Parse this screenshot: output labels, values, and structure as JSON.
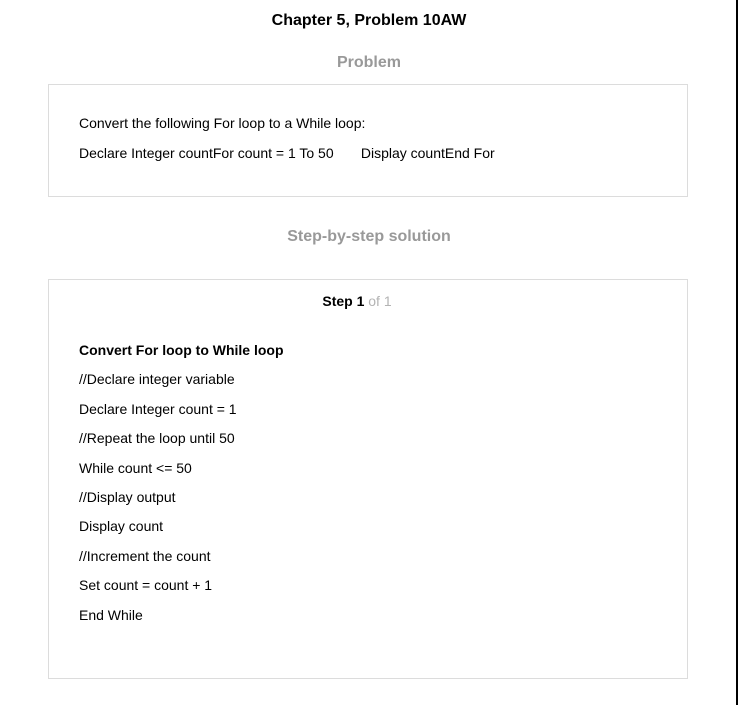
{
  "page_title": "Chapter 5, Problem 10AW",
  "problem": {
    "heading": "Problem",
    "line1": "Convert the following For loop to a While loop:",
    "line2": "Declare Integer countFor count = 1 To 50       Display countEnd For"
  },
  "solution": {
    "heading": "Step-by-step solution",
    "step_word": "Step 1",
    "step_of": "of 1",
    "title": "Convert For loop to While loop",
    "lines": [
      "//Declare integer variable",
      "Declare Integer count = 1",
      "//Repeat the loop until 50",
      "While count <= 50",
      "//Display output",
      "Display count",
      "//Increment the count",
      "Set count = count + 1",
      "End While"
    ]
  }
}
